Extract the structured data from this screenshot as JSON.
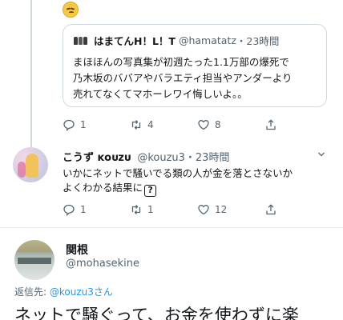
{
  "quoted_tweet": {
    "emoji": "pensive-face",
    "author_name": "はまてんH！L！T",
    "author_handle": "@hamatatz",
    "time": "・23時間",
    "text_lines": [
      "まほほんの写真集が初週たった1.1万部の爆死で",
      "乃木坂のババアやバラエティ担当やアンダーより",
      "売れてなくてマホーレワイ悔しいよ。。"
    ]
  },
  "parent_actions": {
    "reply_count": "1",
    "retweet_count": "4",
    "like_count": "8"
  },
  "reply_tweet": {
    "author_name": "こうず ᴋᴏᴜᴢᴜ",
    "author_handle": "@kouzu3",
    "time": "・23時間",
    "text_line1": "いかにネットで騒いでる類の人が金を落とさないか",
    "text_line2": "よくわかる結果に",
    "text_emoji": "?"
  },
  "reply_actions": {
    "reply_count": "1",
    "retweet_count": "1",
    "like_count": "12"
  },
  "main_tweet": {
    "author_name": "関根",
    "author_handle": "@mohasekine",
    "replying_label": "返信先: ",
    "replying_to": "@kouzu3さん",
    "text": "ネットで騒ぐって、お金を使わずに楽"
  },
  "colors": {
    "accent": "#1d9bf0",
    "secondary_text": "#536471",
    "border": "#cfd9de"
  }
}
